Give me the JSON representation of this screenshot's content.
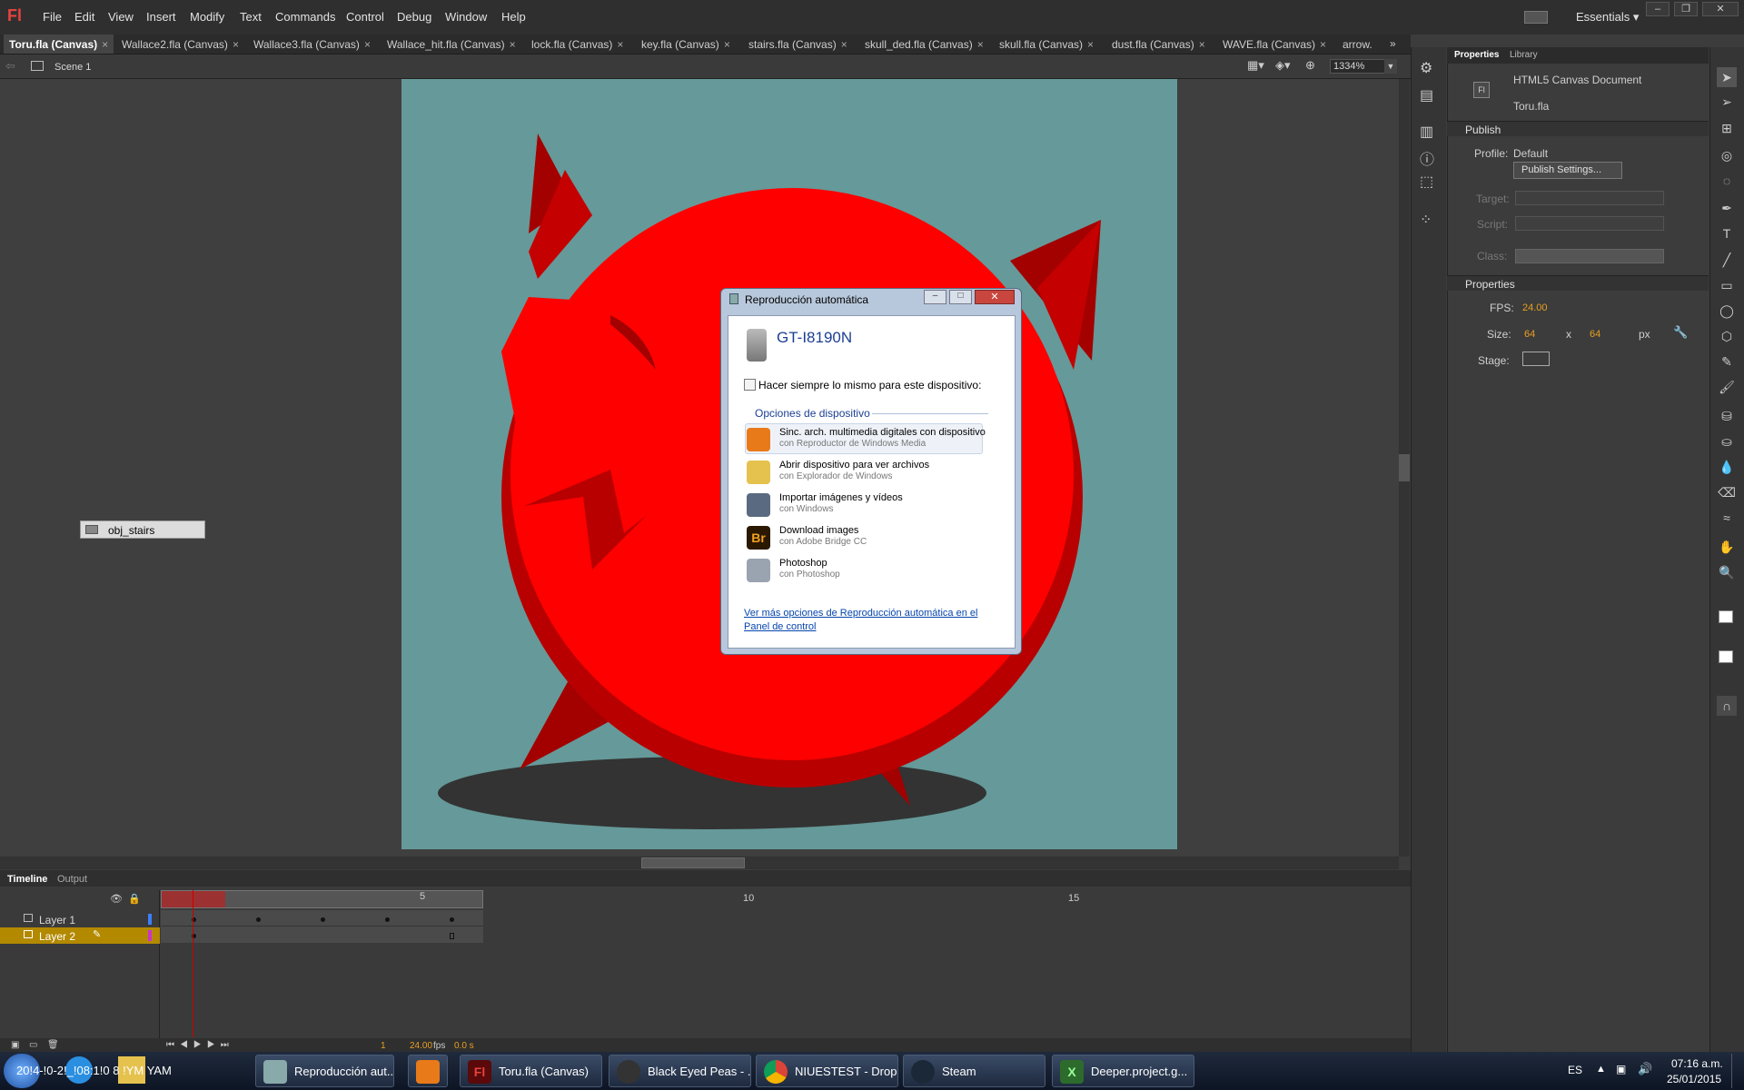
{
  "app": {
    "logo": "Fl",
    "menu": [
      "File",
      "Edit",
      "View",
      "Insert",
      "Modify",
      "Text",
      "Commands",
      "Control",
      "Debug",
      "Window",
      "Help"
    ],
    "workspace": "Essentials"
  },
  "tabs": [
    {
      "label": "Toru.fla (Canvas)",
      "active": true
    },
    {
      "label": "Wallace2.fla (Canvas)"
    },
    {
      "label": "Wallace3.fla (Canvas)"
    },
    {
      "label": "Wallace_hit.fla (Canvas)"
    },
    {
      "label": "lock.fla (Canvas)"
    },
    {
      "label": "key.fla (Canvas)"
    },
    {
      "label": "stairs.fla (Canvas)"
    },
    {
      "label": "skull_ded.fla (Canvas)"
    },
    {
      "label": "skull.fla (Canvas)"
    },
    {
      "label": "dust.fla (Canvas)"
    },
    {
      "label": "WAVE.fla (Canvas)"
    },
    {
      "label": "arrow."
    }
  ],
  "scene": {
    "name": "Scene 1",
    "zoom": "1334%"
  },
  "stage": {
    "bg_color": "#669999",
    "object_label": "obj_stairs"
  },
  "timeline": {
    "tabs": [
      "Timeline",
      "Output"
    ],
    "ruler": [
      "5",
      "10",
      "15"
    ],
    "layers": [
      {
        "name": "Layer 1"
      },
      {
        "name": "Layer 2",
        "selected": true
      }
    ],
    "footer": {
      "frame": "1",
      "fps": "24.00",
      "fps_unit": "fps",
      "time": "0.0 s"
    }
  },
  "properties": {
    "tabs": [
      "Properties",
      "Library"
    ],
    "doc_type": "HTML5 Canvas Document",
    "doc_name": "Toru.fla",
    "publish": {
      "header": "Publish",
      "profile_label": "Profile:",
      "profile": "Default",
      "settings_button": "Publish Settings...",
      "target_label": "Target:",
      "script_label": "Script:",
      "class_label": "Class:"
    },
    "props": {
      "header": "Properties",
      "fps_label": "FPS:",
      "fps": "24.00",
      "size_label": "Size:",
      "width": "64",
      "x": "x",
      "height": "64",
      "unit": "px",
      "stage_label": "Stage:"
    }
  },
  "dialog": {
    "title": "Reproducción automática",
    "device": "GT-I8190N",
    "checkbox": "Hacer siempre lo mismo para este dispositivo:",
    "group": "Opciones de dispositivo",
    "options": [
      {
        "title": "Sinc. arch. multimedia digitales con dispositivo",
        "sub": "con Reproductor de Windows Media",
        "icon": "media-player-icon"
      },
      {
        "title": "Abrir dispositivo para ver archivos",
        "sub": "con Explorador de Windows",
        "icon": "folder-icon"
      },
      {
        "title": "Importar imágenes y vídeos",
        "sub": "con Windows",
        "icon": "camera-icon"
      },
      {
        "title": "Download images",
        "sub": "con Adobe Bridge CC",
        "icon": "bridge-icon",
        "icon_text": "Br"
      },
      {
        "title": "Photoshop",
        "sub": "con Photoshop",
        "icon": "scanner-icon"
      }
    ],
    "link": "Ver más opciones de Reproducción automática en el Panel de control"
  },
  "taskbar": {
    "items": [
      {
        "label": "20!4-!0-2!_!08:1!0 8 !YM YAM"
      },
      {
        "label": "Reproducción aut..."
      },
      {
        "label": ""
      },
      {
        "label": "Toru.fla (Canvas)"
      },
      {
        "label": "Black Eyed Peas - ..."
      },
      {
        "label": "NIUESTEST - Drop..."
      },
      {
        "label": "Steam"
      },
      {
        "label": "Deeper.project.g..."
      }
    ],
    "lang": "ES",
    "time": "07:16 a.m.",
    "date": "25/01/2015"
  }
}
